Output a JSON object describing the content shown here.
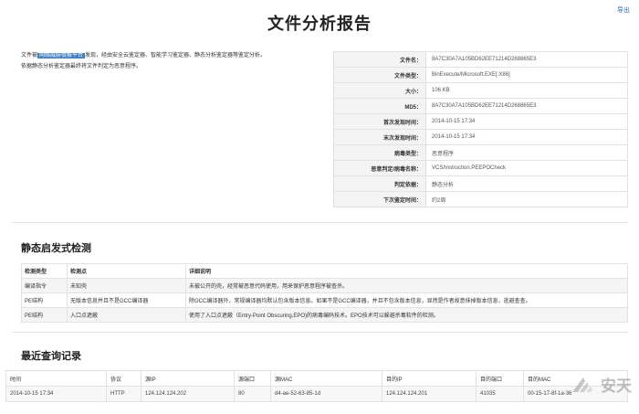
{
  "header": {
    "title": "文件分析报告",
    "export_label": "导出"
  },
  "summary": {
    "prefix": "文件被",
    "highlight": "网络威胁情报平台",
    "rest": "发现，经由安全云鉴定器、智能学习鉴定器、静态分析鉴定器等鉴定分析。",
    "line2": "依据静态分析鉴定器最终将文件判定为恶意程序。"
  },
  "file_info": [
    {
      "label": "文件名：",
      "value": "8A7C30A7A105BD62EE71214D268865E3"
    },
    {
      "label": "文件类型：",
      "value": "BinExecute/Microsoft.EXE[:X86]"
    },
    {
      "label": "大小：",
      "value": "106 KB"
    },
    {
      "label": "MD5：",
      "value": "8A7C30A7A105BD62EE71214D268865E3"
    },
    {
      "label": "首次发现时间：",
      "value": "2014-10-15 17:34"
    },
    {
      "label": "末次发现时间：",
      "value": "2014-10-15 17:34"
    },
    {
      "label": "病毒类型：",
      "value": "恶意程序"
    },
    {
      "label": "恶意判定/病毒名称：",
      "value": "VCS/Instruction.PEEPOCheck"
    },
    {
      "label": "判定依据：",
      "value": "静态分析"
    },
    {
      "label": "下次鉴定时间：",
      "value": "约2周"
    }
  ],
  "heuristic": {
    "title": "静态启发式检测",
    "columns": [
      "检测类型",
      "检测点",
      "详细说明"
    ],
    "rows": [
      [
        "编译指令",
        "未知壳",
        "未被公开的壳，经常被恶意代码使用，用来保护恶意程序被查杀。"
      ],
      [
        "PE结构",
        "无版本信息并且不是GCC编译器",
        "除GCC编译器外，常规编译器均默认包含版本信息。如果不是GCC编译器，并且不包含版本信息，显然是作者故意抹掉版本信息，逃避查查。"
      ],
      [
        "PE结构",
        "入口点遮蔽",
        "使用了入口点遮蔽（Entry-Point Obscuring,EPO)的病毒编码技术。EPO技术可以躲避杀毒软件的检测。"
      ]
    ]
  },
  "queries": {
    "title": "最近查询记录",
    "columns": [
      "时间",
      "协议",
      "源IP",
      "源端口",
      "源MAC",
      "目的IP",
      "目的端口",
      "目的MAC"
    ],
    "rows": [
      [
        "2014-10-15 17:34",
        "HTTP",
        "124.124.124.202",
        "80",
        "d4-ae-52-63-85-1d",
        "124.124.124.201",
        "41035",
        "00-15-17-8f-1a-36"
      ]
    ]
  },
  "watermark": {
    "text": "安天",
    "icon": "antiy-logo"
  }
}
